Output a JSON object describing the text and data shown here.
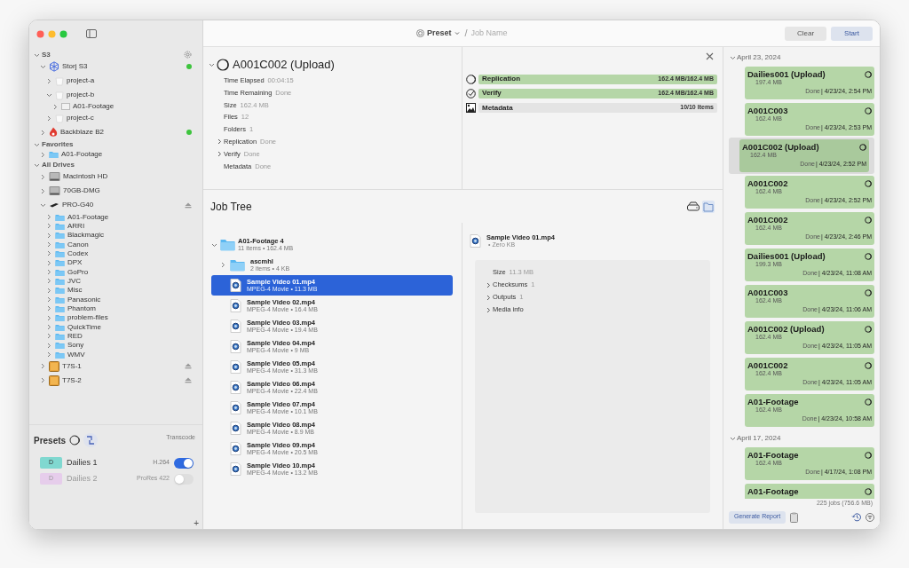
{
  "sidebar": {
    "sections": [
      {
        "title": "S3",
        "expanded": true,
        "items": [
          {
            "label": "Storj S3",
            "kind": "cloud",
            "expanded": true,
            "online": true,
            "ejectable": false,
            "children": [
              {
                "label": "project-a",
                "kind": "bucket",
                "expanded": false
              },
              {
                "label": "project-b",
                "kind": "bucket",
                "expanded": true,
                "children": [
                  {
                    "label": "A01-Footage",
                    "kind": "prefix",
                    "expanded": false
                  }
                ]
              },
              {
                "label": "project-c",
                "kind": "bucket",
                "expanded": false
              }
            ]
          },
          {
            "label": "Backblaze B2",
            "kind": "flame",
            "expanded": false,
            "online": true,
            "ejectable": false
          }
        ]
      },
      {
        "title": "Favorites",
        "expanded": true,
        "items": [
          {
            "label": "A01-Footage",
            "kind": "folder",
            "expanded": false,
            "online": false,
            "ejectable": false
          }
        ]
      },
      {
        "title": "All Drives",
        "expanded": true,
        "items": [
          {
            "label": "Macintosh HD",
            "kind": "disk",
            "expanded": false,
            "online": false,
            "ejectable": false
          },
          {
            "label": "70GB-DMG",
            "kind": "disk",
            "expanded": false,
            "online": false,
            "ejectable": false
          },
          {
            "label": "PRO-G40",
            "kind": "ssd",
            "expanded": true,
            "online": false,
            "ejectable": true,
            "children": [
              {
                "label": "A01-Footage",
                "kind": "folder",
                "expanded": false
              },
              {
                "label": "ARRI",
                "kind": "folder",
                "expanded": false
              },
              {
                "label": "Blackmagic",
                "kind": "folder",
                "expanded": false
              },
              {
                "label": "Canon",
                "kind": "folder",
                "expanded": false
              },
              {
                "label": "Codex",
                "kind": "folder",
                "expanded": false
              },
              {
                "label": "DPX",
                "kind": "folder",
                "expanded": false
              },
              {
                "label": "GoPro",
                "kind": "folder",
                "expanded": false
              },
              {
                "label": "JVC",
                "kind": "folder",
                "expanded": false
              },
              {
                "label": "Misc",
                "kind": "folder",
                "expanded": false
              },
              {
                "label": "Panasonic",
                "kind": "folder",
                "expanded": false
              },
              {
                "label": "Phantom",
                "kind": "folder",
                "expanded": false
              },
              {
                "label": "problem-files",
                "kind": "folder",
                "expanded": false
              },
              {
                "label": "QuickTime",
                "kind": "folder",
                "expanded": false
              },
              {
                "label": "RED",
                "kind": "folder",
                "expanded": false
              },
              {
                "label": "Sony",
                "kind": "folder",
                "expanded": false
              },
              {
                "label": "WMV",
                "kind": "folder",
                "expanded": false
              }
            ]
          },
          {
            "label": "T7S-1",
            "kind": "usb",
            "expanded": false,
            "online": false,
            "ejectable": true
          },
          {
            "label": "T7S-2",
            "kind": "usb",
            "expanded": false,
            "online": false,
            "ejectable": true
          }
        ]
      }
    ]
  },
  "presets": {
    "title": "Presets",
    "column_label": "Transcode",
    "items": [
      {
        "badge": "D",
        "name": "Dailies 1",
        "format": "H.264",
        "on": true,
        "color": "#80d8d0"
      },
      {
        "badge": "D",
        "name": "Dailies 2",
        "format": "ProRes 422",
        "on": false,
        "color": "#e6cdeb"
      }
    ],
    "add": "+"
  },
  "toolbar": {
    "preset": "Preset",
    "separator": "/",
    "job_name_placeholder": "Job Name",
    "buttons": [
      {
        "label": "Clear",
        "kind": "secondary"
      },
      {
        "label": "Start",
        "kind": "primary"
      }
    ]
  },
  "job": {
    "title": "A001C002 (Upload)",
    "expanded": true,
    "properties": [
      {
        "label": "Time Elapsed",
        "value": "00:04:15",
        "collapsible": false
      },
      {
        "label": "Time Remaining",
        "value": "Done",
        "collapsible": false
      },
      {
        "label": "Size",
        "value": "162.4 MB",
        "collapsible": false
      },
      {
        "label": "Files",
        "value": "12",
        "collapsible": false
      },
      {
        "label": "Folders",
        "value": "1",
        "collapsible": false
      },
      {
        "label": "Replication",
        "value": "Done",
        "collapsible": true
      },
      {
        "label": "Verify",
        "value": "Done",
        "collapsible": true
      },
      {
        "label": "Metadata",
        "value": "Done",
        "collapsible": false
      }
    ]
  },
  "progress": [
    {
      "label": "Replication",
      "kind": "replicate",
      "reading": "162.4 MB/162.4 MB",
      "level": 1,
      "color": "#b5d6a7"
    },
    {
      "label": "Verify",
      "kind": "verify",
      "reading": "162.4 MB/162.4 MB",
      "level": 1,
      "color": "#b5d6a7"
    },
    {
      "label": "Metadata",
      "kind": "metadata",
      "reading": "10/10 Items",
      "level": 1,
      "color": "#e4e4e4"
    }
  ],
  "job_tree": {
    "title": "Job Tree",
    "root": {
      "name": "A01-Footage 4",
      "meta": "11 items • 162.4 MB",
      "expanded": true,
      "children": [
        {
          "name": "ascmhl",
          "kind": "folder",
          "meta": "2 items • 4 KB",
          "selected": false
        },
        {
          "name": "Sample Video 01.mp4",
          "kind": "movie",
          "meta": "MPEG-4 Movie • 11.3 MB",
          "selected": true
        },
        {
          "name": "Sample Video 02.mp4",
          "kind": "movie",
          "meta": "MPEG-4 Movie • 16.4 MB",
          "selected": false
        },
        {
          "name": "Sample Video 03.mp4",
          "kind": "movie",
          "meta": "MPEG-4 Movie • 19.4 MB",
          "selected": false
        },
        {
          "name": "Sample Video 04.mp4",
          "kind": "movie",
          "meta": "MPEG-4 Movie • 9 MB",
          "selected": false
        },
        {
          "name": "Sample Video 05.mp4",
          "kind": "movie",
          "meta": "MPEG-4 Movie • 31.3 MB",
          "selected": false
        },
        {
          "name": "Sample Video 06.mp4",
          "kind": "movie",
          "meta": "MPEG-4 Movie • 22.4 MB",
          "selected": false
        },
        {
          "name": "Sample Video 07.mp4",
          "kind": "movie",
          "meta": "MPEG-4 Movie • 10.1 MB",
          "selected": false
        },
        {
          "name": "Sample Video 08.mp4",
          "kind": "movie",
          "meta": "MPEG-4 Movie • 8.9 MB",
          "selected": false
        },
        {
          "name": "Sample Video 09.mp4",
          "kind": "movie",
          "meta": "MPEG-4 Movie • 20.5 MB",
          "selected": false
        },
        {
          "name": "Sample Video 10.mp4",
          "kind": "movie",
          "meta": "MPEG-4 Movie • 13.2 MB",
          "selected": false
        }
      ]
    }
  },
  "inspector": {
    "name": "Sample Video 01.mp4",
    "meta": "• Zero KB",
    "rows": [
      {
        "label": "Size",
        "value": "11.3 MB",
        "collapsible": false
      },
      {
        "label": "Checksums",
        "value": "1",
        "collapsible": true
      },
      {
        "label": "Outputs",
        "value": "1",
        "collapsible": true
      },
      {
        "label": "Media info",
        "collapsible": true
      }
    ]
  },
  "history": {
    "groups": [
      {
        "date": "April 23, 2024",
        "expanded": true,
        "jobs": [
          {
            "name": "Dailies001 (Upload)",
            "size": "197.4 MB",
            "status": "Done",
            "time": "| 4/23/24, 2:54 PM",
            "selected": false
          },
          {
            "name": "A001C003",
            "size": "162.4 MB",
            "status": "Done",
            "time": "| 4/23/24, 2:53 PM",
            "selected": false
          },
          {
            "name": "A001C002 (Upload)",
            "size": "162.4 MB",
            "status": "Done",
            "time": "| 4/23/24, 2:52 PM",
            "selected": true
          },
          {
            "name": "A001C002",
            "size": "162.4 MB",
            "status": "Done",
            "time": "| 4/23/24, 2:52 PM",
            "selected": false
          },
          {
            "name": "A001C002",
            "size": "162.4 MB",
            "status": "Done",
            "time": "| 4/23/24, 2:46 PM",
            "selected": false
          },
          {
            "name": "Dailies001 (Upload)",
            "size": "199.3 MB",
            "status": "Done",
            "time": "| 4/23/24, 11:08 AM",
            "selected": false
          },
          {
            "name": "A001C003",
            "size": "162.4 MB",
            "status": "Done",
            "time": "| 4/23/24, 11:06 AM",
            "selected": false
          },
          {
            "name": "A001C002 (Upload)",
            "size": "162.4 MB",
            "status": "Done",
            "time": "| 4/23/24, 11:05 AM",
            "selected": false
          },
          {
            "name": "A001C002",
            "size": "162.4 MB",
            "status": "Done",
            "time": "| 4/23/24, 11:05 AM",
            "selected": false
          },
          {
            "name": "A01-Footage",
            "size": "162.4 MB",
            "status": "Done",
            "time": "| 4/23/24, 10:58 AM",
            "selected": false
          }
        ]
      },
      {
        "date": "April 17, 2024",
        "expanded": true,
        "jobs": [
          {
            "name": "A01-Footage",
            "size": "162.4 MB",
            "status": "Done",
            "time": "| 4/17/24, 1:08 PM",
            "selected": false
          },
          {
            "name": "A01-Footage",
            "selected": false
          }
        ]
      }
    ],
    "summary": "225 jobs (756.6 MB)",
    "report_button": "Generate Report"
  }
}
